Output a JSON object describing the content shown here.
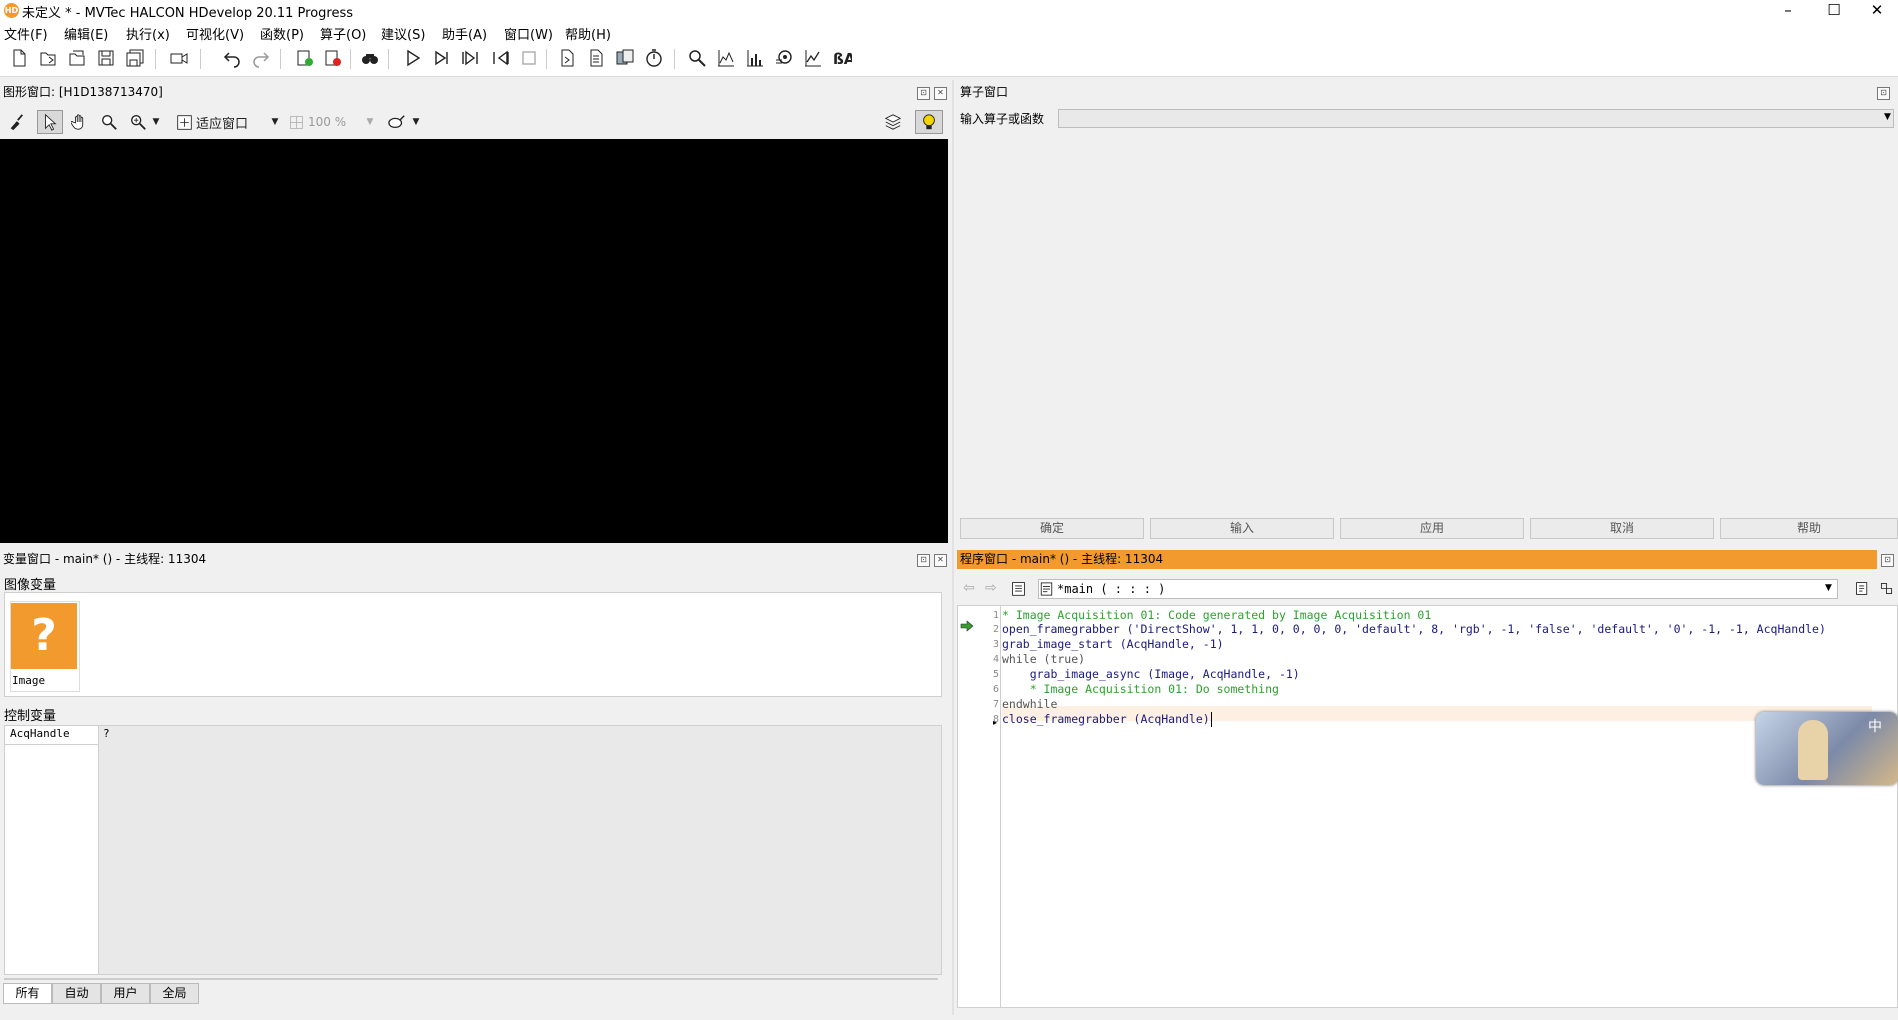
{
  "window": {
    "title": "未定义 * - MVTec HALCON HDevelop 20.11 Progress",
    "logo": "HD",
    "minimize": "–",
    "maximize": "☐",
    "close": "✕"
  },
  "menu": [
    "文件(F)",
    "编辑(E)",
    "执行(x)",
    "可视化(V)",
    "函数(P)",
    "算子(O)",
    "建议(S)",
    "助手(A)",
    "窗口(W)",
    "帮助(H)"
  ],
  "graphics": {
    "title": "图形窗口: [H1D138713470]",
    "fit_label": "适应窗口",
    "zoom_label": "100 %"
  },
  "operator": {
    "title": "算子窗口",
    "input_label": "输入算子或函数",
    "buttons": [
      "确定",
      "输入",
      "应用",
      "取消",
      "帮助"
    ]
  },
  "variables": {
    "title": "变量窗口 - main* () - 主线程: 11304",
    "image_section": "图像变量",
    "image_var_name": "Image",
    "image_var_symbol": "?",
    "control_section": "控制变量",
    "control_vars": [
      {
        "name": "AcqHandle",
        "value": "?"
      }
    ],
    "tabs": [
      "所有",
      "自动",
      "用户",
      "全局"
    ]
  },
  "program": {
    "title": "程序窗口 - main* () - 主线程: 11304",
    "procedure": "*main ( : : : )",
    "lines": [
      {
        "n": "1",
        "text": "* Image Acquisition 01: Code generated by Image Acquisition 01",
        "kind": "cmt"
      },
      {
        "n": "2",
        "text": "open_framegrabber ('DirectShow', 1, 1, 0, 0, 0, 0, 'default', 8, 'rgb', -1, 'false', 'default', '0', -1, -1, AcqHandle)",
        "kind": "op"
      },
      {
        "n": "3",
        "text": "grab_image_start (AcqHandle, -1)",
        "kind": "op"
      },
      {
        "n": "4",
        "text": "while (true)",
        "kind": "kw"
      },
      {
        "n": "5",
        "text": "    grab_image_async (Image, AcqHandle, -1)",
        "kind": "op"
      },
      {
        "n": "6",
        "text": "    * Image Acquisition 01: Do something",
        "kind": "cmt"
      },
      {
        "n": "7",
        "text": "endwhile",
        "kind": "kw"
      },
      {
        "n": "8",
        "text": "close_framegrabber (AcqHandle)",
        "kind": "op"
      }
    ],
    "ime_label": "中"
  },
  "colors": {
    "accent": "#f29a2e",
    "comment": "#2fa02f",
    "operator": "#1a1a80"
  }
}
